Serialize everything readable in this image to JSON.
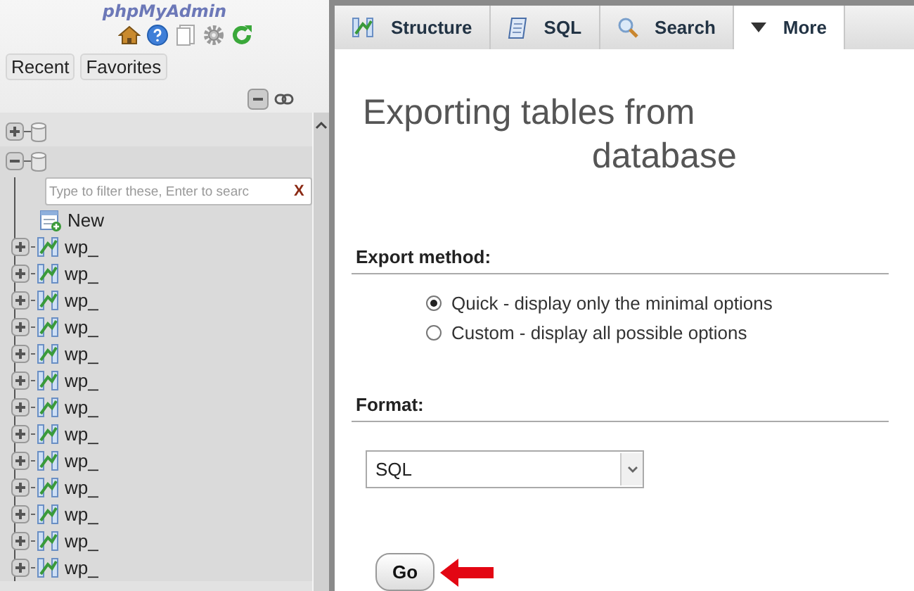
{
  "sidebar": {
    "logo": "phpMyAdmin",
    "tabs": [
      {
        "label": "Recent"
      },
      {
        "label": "Favorites"
      }
    ],
    "databases": [
      {
        "expanded": false
      },
      {
        "expanded": true,
        "filter": {
          "placeholder": "Type to filter these, Enter to searc",
          "clear": "X"
        },
        "children": [
          {
            "kind": "new",
            "label": "New"
          },
          {
            "kind": "table",
            "label": "wp_"
          },
          {
            "kind": "table",
            "label": "wp_"
          },
          {
            "kind": "table",
            "label": "wp_"
          },
          {
            "kind": "table",
            "label": "wp_"
          },
          {
            "kind": "table",
            "label": "wp_"
          },
          {
            "kind": "table",
            "label": "wp_"
          },
          {
            "kind": "table",
            "label": "wp_"
          },
          {
            "kind": "table",
            "label": "wp_"
          },
          {
            "kind": "table",
            "label": "wp_"
          },
          {
            "kind": "table",
            "label": "wp_"
          },
          {
            "kind": "table",
            "label": "wp_"
          },
          {
            "kind": "table",
            "label": "wp_"
          },
          {
            "kind": "table",
            "label": "wp_"
          }
        ]
      }
    ]
  },
  "tabs": [
    {
      "label": "Structure",
      "selected": false
    },
    {
      "label": "SQL",
      "selected": false
    },
    {
      "label": "Search",
      "selected": false
    },
    {
      "label": "More",
      "selected": true
    }
  ],
  "title": "Exporting tables from database",
  "export_method": {
    "heading": "Export method:",
    "options": [
      {
        "label": "Quick - display only the minimal options",
        "selected": true
      },
      {
        "label": "Custom - display all possible options",
        "selected": false
      }
    ]
  },
  "format": {
    "heading": "Format:",
    "value": "SQL"
  },
  "go_button": "Go"
}
